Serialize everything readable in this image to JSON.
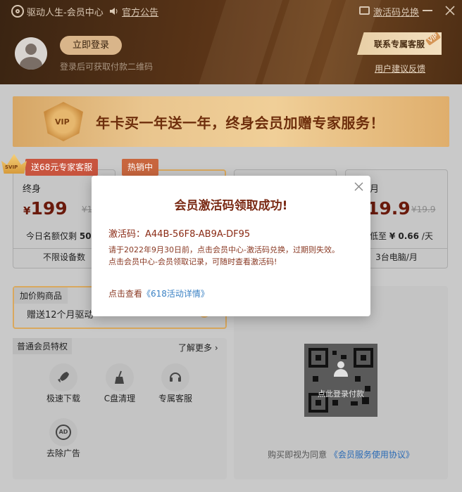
{
  "titlebar": {
    "app_title": "驱动人生-会员中心",
    "announcement": "官方公告",
    "activation_redeem": "激活码兑换"
  },
  "user": {
    "login_button": "立即登录",
    "login_hint": "登录后可获取付款二维码"
  },
  "header_right": {
    "service_button": "联系专属客服",
    "vip_badge": "VIP",
    "feedback_link": "用户建议反馈"
  },
  "banner": {
    "vip_text": "VIP",
    "text": "年卡买一年送一年，终身会员加赠专家服务！"
  },
  "plans": {
    "svip_badge": "SVIP",
    "lifetime_tag": "送68元专家客服",
    "hot_tag": "热销中",
    "lifetime": {
      "name": "终身",
      "currency": "¥",
      "price": "199",
      "orig": "¥1",
      "quota_prefix": "今日名额仅剩",
      "quota_value": "50",
      "footer": "不限设备数"
    },
    "monthly": {
      "name": "月",
      "price": "19.9",
      "orig": "¥19.9",
      "daily_prefix": "低至",
      "daily_value": "¥ 0.66",
      "daily_unit": "/天",
      "footer": "3台电脑/月"
    }
  },
  "addon": {
    "title": "加价购商品",
    "text": "赠送12个月驱动"
  },
  "privileges": {
    "title": "普通会员特权",
    "more": "了解更多",
    "items": [
      "极速下载",
      "C盘清理",
      "专属客服",
      "去除广告"
    ],
    "ad_icon_text": "AD"
  },
  "qr": {
    "overlay": "点此登录付款",
    "agreement_prefix": "购买即视为同意",
    "agreement_link": "《会员服务使用协议》"
  },
  "modal": {
    "title": "会员激活码领取成功!",
    "code_label": "激活码：",
    "code": "A44B-56F8-AB9A-DF95",
    "line1": "请于2022年9月30日前，点击会员中心-激活码兑换，过期则失效。",
    "line2": "点击会员中心-会员领取记录，可随时查看激活码!",
    "link_prefix": "点击查看",
    "link": "《618活动详情》"
  }
}
